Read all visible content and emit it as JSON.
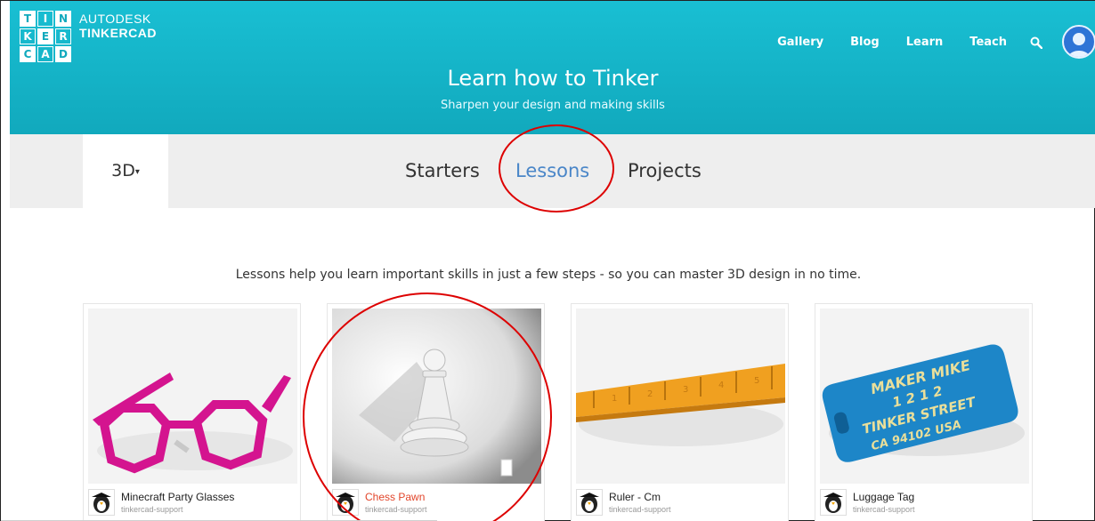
{
  "brand": {
    "logo_letters": [
      "T",
      "I",
      "N",
      "K",
      "E",
      "R",
      "C",
      "A",
      "D"
    ],
    "autodesk": "AUTODESK",
    "tinkercad": "TINKERCAD"
  },
  "nav": {
    "gallery": "Gallery",
    "blog": "Blog",
    "learn": "Learn",
    "teach": "Teach"
  },
  "hero": {
    "title": "Learn how to Tinker",
    "subtitle": "Sharpen your design and making skills"
  },
  "tabs": {
    "dimension": "3D",
    "starters": "Starters",
    "lessons": "Lessons",
    "projects": "Projects",
    "active": "Lessons"
  },
  "intro": "Lessons help you learn important skills in just a few steps - so you can master 3D design in no time.",
  "cards": [
    {
      "title": "Minecraft Party Glasses",
      "author": "tinkercad-support"
    },
    {
      "title": "Chess Pawn",
      "author": "tinkercad-support"
    },
    {
      "title": "Ruler - Cm",
      "author": "tinkercad-support"
    },
    {
      "title": "Luggage Tag",
      "author": "tinkercad-support"
    }
  ],
  "luggage_tag_text": [
    "MAKER MIKE",
    "1 2 1 2",
    "TINKER STREET",
    "CA 94102 USA"
  ],
  "colors": {
    "header": "#11a9bd",
    "active_tab": "#4a86c8",
    "annotation": "#dd0000",
    "highlight_title": "#e2452a"
  },
  "icons": {
    "search": "search-icon",
    "avatar": "user-avatar-icon",
    "dropdown": "caret-down-icon"
  }
}
